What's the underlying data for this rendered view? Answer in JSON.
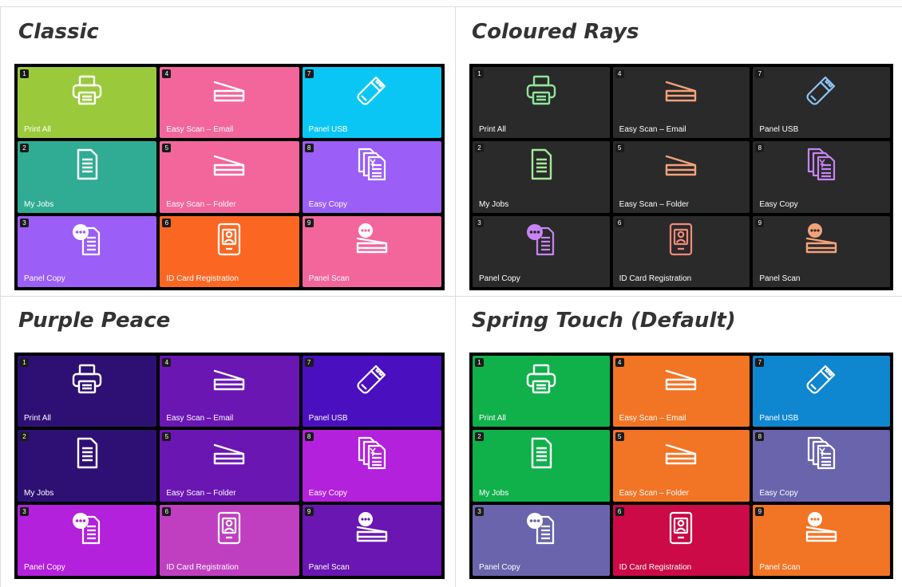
{
  "tile_labels": [
    "Print All",
    "My Jobs",
    "Panel Copy",
    "Easy Scan – Email",
    "Easy Scan – Folder",
    "ID Card Registration",
    "Panel USB",
    "Easy Copy",
    "Panel Scan"
  ],
  "tile_numbers": [
    "1",
    "2",
    "3",
    "4",
    "5",
    "6",
    "7",
    "8",
    "9"
  ],
  "tile_icons": [
    "printer-icon",
    "document-icon",
    "chat-document-icon",
    "scanner-icon",
    "scanner-icon",
    "id-card-icon",
    "usb-icon",
    "copy-icon",
    "chat-scanner-icon"
  ],
  "themes": [
    {
      "title": "Classic",
      "tile_colors": [
        "#9aca3c",
        "#2fac93",
        "#9b5ef7",
        "#f2669b",
        "#f2669b",
        "#fb6722",
        "#0ac6f4",
        "#9b5ef7",
        "#f2669b"
      ],
      "icon_colors": [
        "#ffffff",
        "#ffffff",
        "#ffffff",
        "#ffffff",
        "#ffffff",
        "#ffffff",
        "#ffffff",
        "#ffffff",
        "#ffffff"
      ]
    },
    {
      "title": "Coloured Rays",
      "tile_colors": [
        "#2a2a2a",
        "#2a2a2a",
        "#2a2a2a",
        "#2a2a2a",
        "#2a2a2a",
        "#2a2a2a",
        "#2a2a2a",
        "#2a2a2a",
        "#2a2a2a"
      ],
      "icon_colors": [
        "#8fe59b",
        "#a6ea98",
        "#c884f4",
        "#f3a27a",
        "#f3a27a",
        "#f28a79",
        "#8ec4f3",
        "#c884f4",
        "#f3a27a"
      ]
    },
    {
      "title": "Purple Peace",
      "tile_colors": [
        "#2e1074",
        "#2e1074",
        "#b321dd",
        "#6a16b3",
        "#6a16b3",
        "#c03fc1",
        "#4a10c0",
        "#b321dd",
        "#6a16b3"
      ],
      "icon_colors": [
        "#ffffff",
        "#ffffff",
        "#ffffff",
        "#ffffff",
        "#ffffff",
        "#ffffff",
        "#ffffff",
        "#ffffff",
        "#ffffff"
      ]
    },
    {
      "title": "Spring Touch (Default)",
      "tile_colors": [
        "#10b04b",
        "#10b04b",
        "#6a64ad",
        "#f27425",
        "#f27425",
        "#cb0a47",
        "#0f86d0",
        "#6a64ad",
        "#f27425"
      ],
      "icon_colors": [
        "#ffffff",
        "#ffffff",
        "#ffffff",
        "#ffffff",
        "#ffffff",
        "#ffffff",
        "#ffffff",
        "#ffffff",
        "#ffffff"
      ]
    }
  ]
}
